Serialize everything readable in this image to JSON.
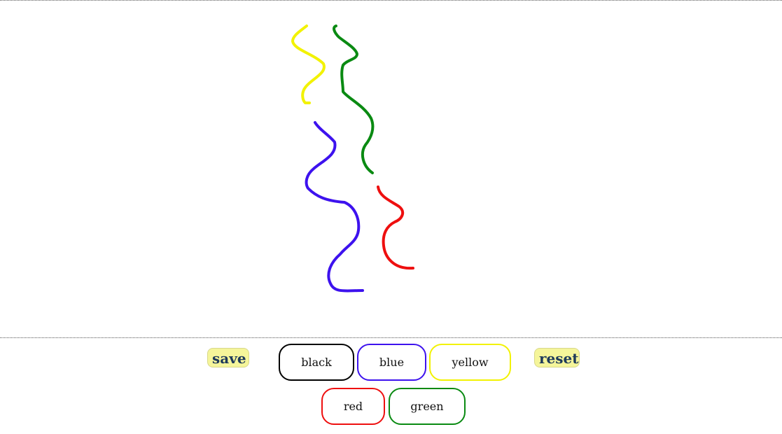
{
  "toolbar": {
    "save_label": "save",
    "reset_label": "reset"
  },
  "palette": [
    {
      "name": "black",
      "label": "black",
      "color": "#000000"
    },
    {
      "name": "blue",
      "label": "blue",
      "color": "#3d12ee"
    },
    {
      "name": "yellow",
      "label": "yellow",
      "color": "#f2f200"
    },
    {
      "name": "red",
      "label": "red",
      "color": "#ee0f0f"
    },
    {
      "name": "green",
      "label": "green",
      "color": "#0a8a12"
    }
  ],
  "strokes": [
    {
      "color": "yellow"
    },
    {
      "color": "green"
    },
    {
      "color": "blue"
    },
    {
      "color": "red"
    }
  ],
  "colors": {
    "action_bg": "#f5f59a",
    "action_text": "#1e3a5a"
  }
}
